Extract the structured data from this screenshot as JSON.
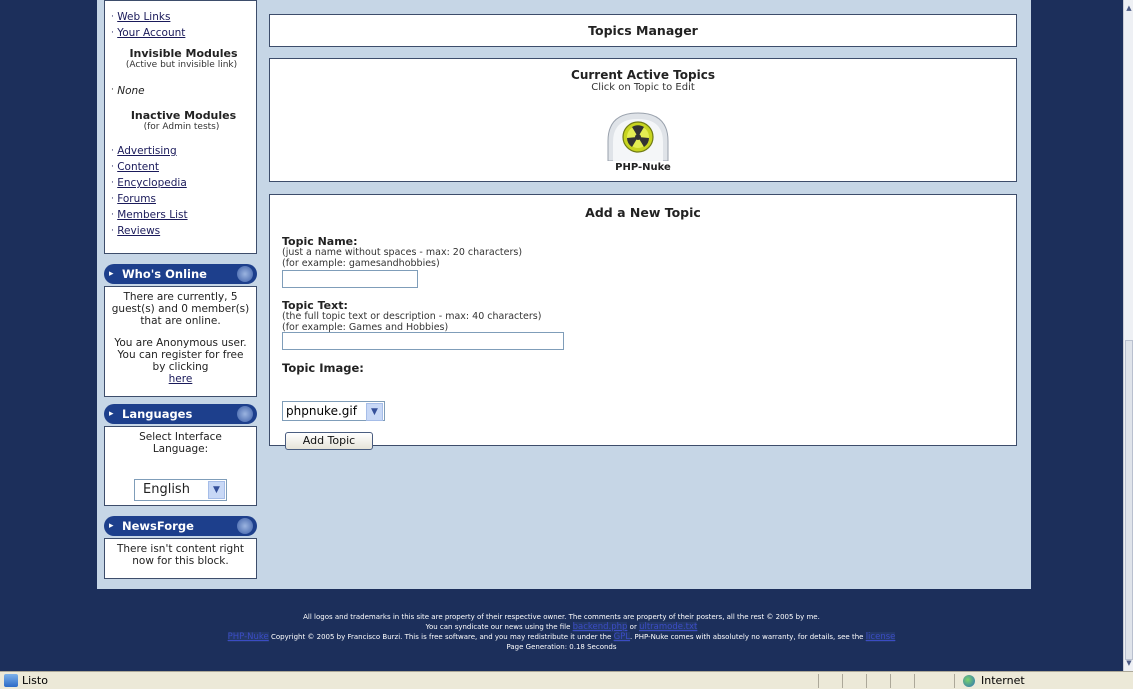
{
  "left_nav": {
    "links": [
      "Web Links",
      "Your Account"
    ],
    "invisible_heading": "Invisible Modules",
    "invisible_sub": "(Active but invisible link)",
    "invisible_none": "None",
    "inactive_heading": "Inactive Modules",
    "inactive_sub": "(for Admin tests)",
    "inactive_links": [
      "Advertising",
      "Content",
      "Encyclopedia",
      "Forums",
      "Members List",
      "Reviews"
    ],
    "bullet": "·"
  },
  "whos_online": {
    "title": "Who's Online",
    "text1": "There are currently, 5 guest(s) and 0 member(s) that are online.",
    "text2": "You are Anonymous user. You can register for free by clicking",
    "link": "here"
  },
  "languages": {
    "title": "Languages",
    "text": "Select Interface Language:",
    "selected": "English"
  },
  "newsforge": {
    "title": "NewsForge",
    "text": "There isn't content right now for this block."
  },
  "topics_manager": {
    "title": "Topics Manager"
  },
  "active_topics": {
    "title": "Current Active Topics",
    "subtitle": "Click on Topic to Edit",
    "topic": "PHP-Nuke"
  },
  "add_topic": {
    "title": "Add a New Topic",
    "name_label": "Topic Name:",
    "name_hint1": "(just a name without spaces - max: 20 characters)",
    "name_hint2": "(for example: gamesandhobbies)",
    "text_label": "Topic Text:",
    "text_hint1": "(the full topic text or description - max: 40 characters)",
    "text_hint2": "(for example: Games and Hobbies)",
    "image_label": "Topic Image:",
    "image_selected": "phpnuke.gif",
    "button": "Add Topic"
  },
  "footer": {
    "line1": "All logos and trademarks in this site are property of their respective owner. The comments are property of their posters, all the rest © 2005 by me.",
    "line2_pre": "You can syndicate our news using the file",
    "line2_link1": "backend.php",
    "line2_mid": "or",
    "line2_link2": "ultramode.txt",
    "line3_link1": "PHP-Nuke",
    "line3_a": "Copyright © 2005 by Francisco Burzi. This is free software, and you may redistribute it under the",
    "line3_link2": "GPL",
    "line3_b": ". PHP-Nuke comes with absolutely no warranty, for details, see the",
    "line3_link3": "license",
    "line4": "Page Generation: 0.18 Seconds"
  },
  "statusbar": {
    "status": "Listo",
    "zone": "Internet"
  }
}
